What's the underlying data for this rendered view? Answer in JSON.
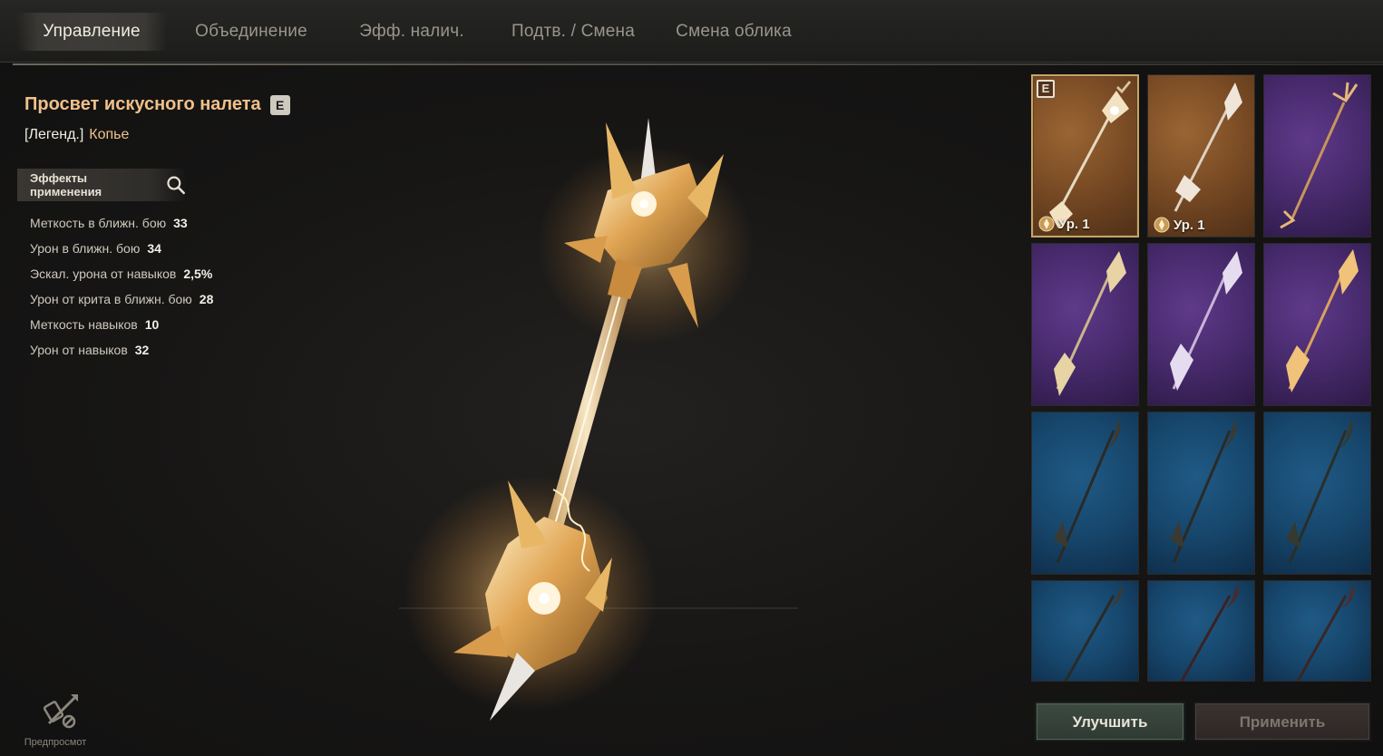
{
  "tabs": [
    {
      "label": "Управление",
      "active": true
    },
    {
      "label": "Объединение",
      "active": false
    },
    {
      "label": "Эфф. налич.",
      "active": false
    },
    {
      "label": "Подтв. / Смена",
      "active": false
    },
    {
      "label": "Смена облика",
      "active": false
    }
  ],
  "item": {
    "name": "Просвет искусного налета",
    "badge": "E",
    "rarity": "[Легенд.]",
    "type": "Копье"
  },
  "effects_button": {
    "label": "Эффекты применения",
    "icon": "search-icon"
  },
  "stats": [
    {
      "label": "Меткость в ближн. бою",
      "value": "33"
    },
    {
      "label": "Урон в ближн. бою",
      "value": "34"
    },
    {
      "label": "Эскал. урона от навыков",
      "value": "2,5%"
    },
    {
      "label": "Урон от крита в ближн. бою",
      "value": "28"
    },
    {
      "label": "Меткость навыков",
      "value": "10"
    },
    {
      "label": "Урон от навыков",
      "value": "32"
    }
  ],
  "preview": {
    "label": "Предпросмот",
    "icon": "preview-icon"
  },
  "inventory": [
    {
      "rarity": "legend",
      "selected": true,
      "equipped_badge": "E",
      "checked": true,
      "level": "Ур. 1"
    },
    {
      "rarity": "legend",
      "selected": false,
      "level": "Ур. 1"
    },
    {
      "rarity": "epic"
    },
    {
      "rarity": "epic"
    },
    {
      "rarity": "epic"
    },
    {
      "rarity": "epic"
    },
    {
      "rarity": "rare"
    },
    {
      "rarity": "rare"
    },
    {
      "rarity": "rare"
    },
    {
      "rarity": "rare"
    },
    {
      "rarity": "rare"
    },
    {
      "rarity": "rare"
    }
  ],
  "buttons": {
    "upgrade": "Улучшить",
    "apply": "Применить"
  },
  "colors": {
    "accent_gold": "#f0c08a",
    "legend_bg": "#7b4c25",
    "epic_bg": "#472a6c",
    "rare_bg": "#17476d"
  }
}
